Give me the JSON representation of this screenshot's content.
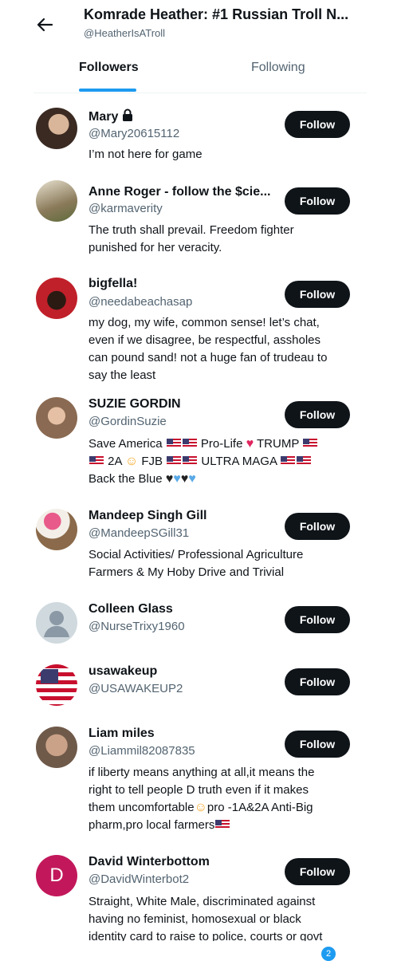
{
  "header": {
    "title": "Komrade Heather: #1 Russian Troll N...",
    "subtitle": "@HeatherIsATroll"
  },
  "tabs": [
    {
      "label": "Followers",
      "active": true
    },
    {
      "label": "Following",
      "active": false
    }
  ],
  "follow_label": "Follow",
  "accent_color": "#1d9bf0",
  "users": [
    {
      "name": "Mary",
      "handle": "@Mary20615112",
      "bio": "I’m not here for game",
      "locked": true
    },
    {
      "name": "Anne Roger - follow the $cie...",
      "handle": "@karmaverity",
      "bio_lines": [
        "The truth shall prevail. Freedom fighter",
        "punished for her veracity."
      ]
    },
    {
      "name": "bigfella!",
      "handle": "@needabeachasap",
      "bio_lines": [
        "my dog, my wife, common sense! let’s chat,",
        "even if we disagree, be respectful, assholes",
        "can pound sand! not a huge fan of trudeau to",
        "say the least"
      ]
    },
    {
      "name": "SUZIE GORDIN",
      "handle": "@GordinSuzie",
      "bio_parts": {
        "l1a": "Save America",
        "l1b": "Pro-Life",
        "l1c": "TRUMP",
        "l2a": "2A",
        "l2b": "FJB",
        "l2c": "ULTRA MAGA",
        "l3a": "Back the Blue"
      }
    },
    {
      "name": "Mandeep Singh Gill",
      "handle": "@MandeepSGill31",
      "bio_lines": [
        "Social Activities/ Professional Agriculture",
        "Farmers & My Hoby Drive and Trivial"
      ]
    },
    {
      "name": "Colleen Glass",
      "handle": "@NurseTrixy1960"
    },
    {
      "name": "usawakeup",
      "handle": "@USAWAKEUP2"
    },
    {
      "name": "Liam miles",
      "handle": "@Liammil82087835",
      "bio_lines": [
        "if liberty means anything at all,it means the",
        "right to tell people D truth even if it makes",
        "them uncomfortable",
        "pro -1A&2A Anti-Big",
        "pharm,pro local farmers"
      ]
    },
    {
      "name": "David Winterbottom",
      "handle": "@DavidWinterbot2",
      "avatar_letter": "D",
      "bio_lines": [
        "Straight, White Male, discriminated against",
        "having no feminist, homosexual or black",
        "identity card to raise to police, courts or govt"
      ]
    }
  ],
  "bottom_badge": "2"
}
